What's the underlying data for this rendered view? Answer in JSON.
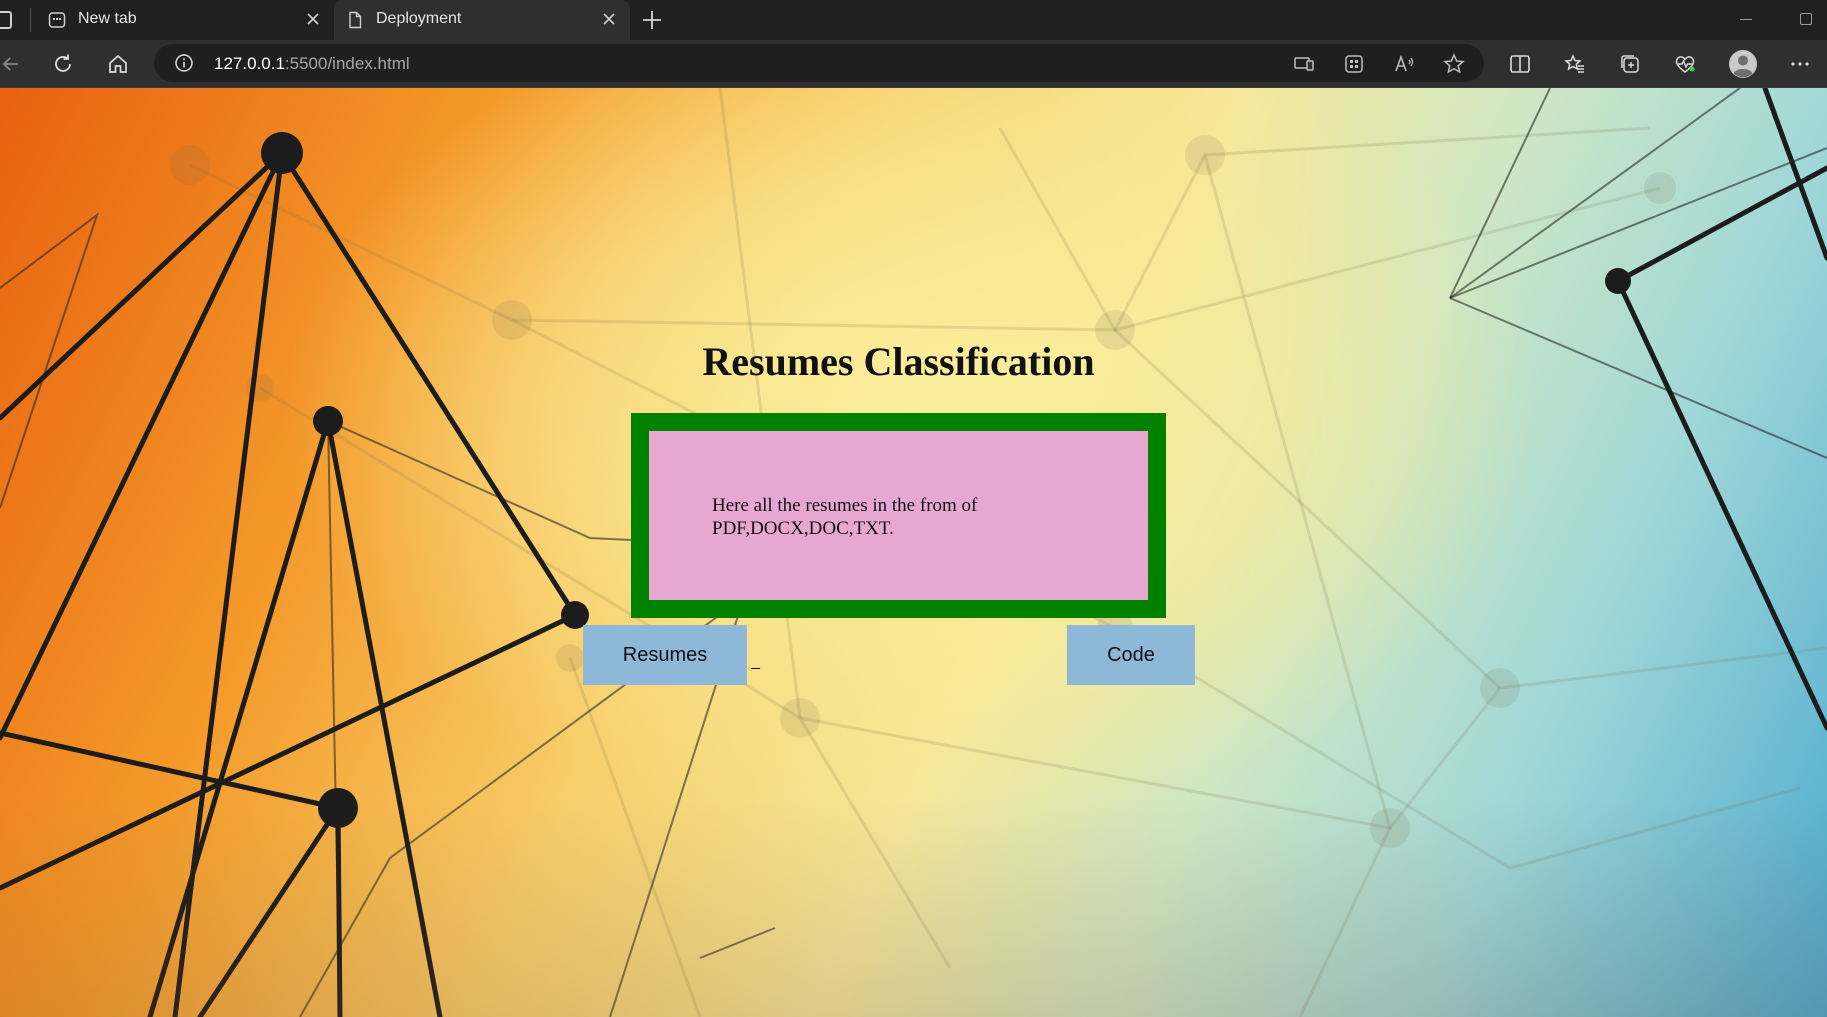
{
  "browser": {
    "tabs": [
      {
        "title": "New tab",
        "icon": "new-tab-page-icon",
        "active": false
      },
      {
        "title": "Deployment",
        "icon": "document-icon",
        "active": true
      }
    ],
    "address": {
      "host": "127.0.0.1",
      "path": ":5500/index.html"
    }
  },
  "page": {
    "title": "Resumes Classification",
    "card_text": "Here all the resumes in the from of PDF,DOCX,DOC,TXT.",
    "card_border_color": "#008000",
    "card_fill_color": "#e6a8d3",
    "buttons": {
      "resumes": "Resumes",
      "code": "Code",
      "button_color": "#8eb8d8"
    },
    "separator_text": "_"
  }
}
